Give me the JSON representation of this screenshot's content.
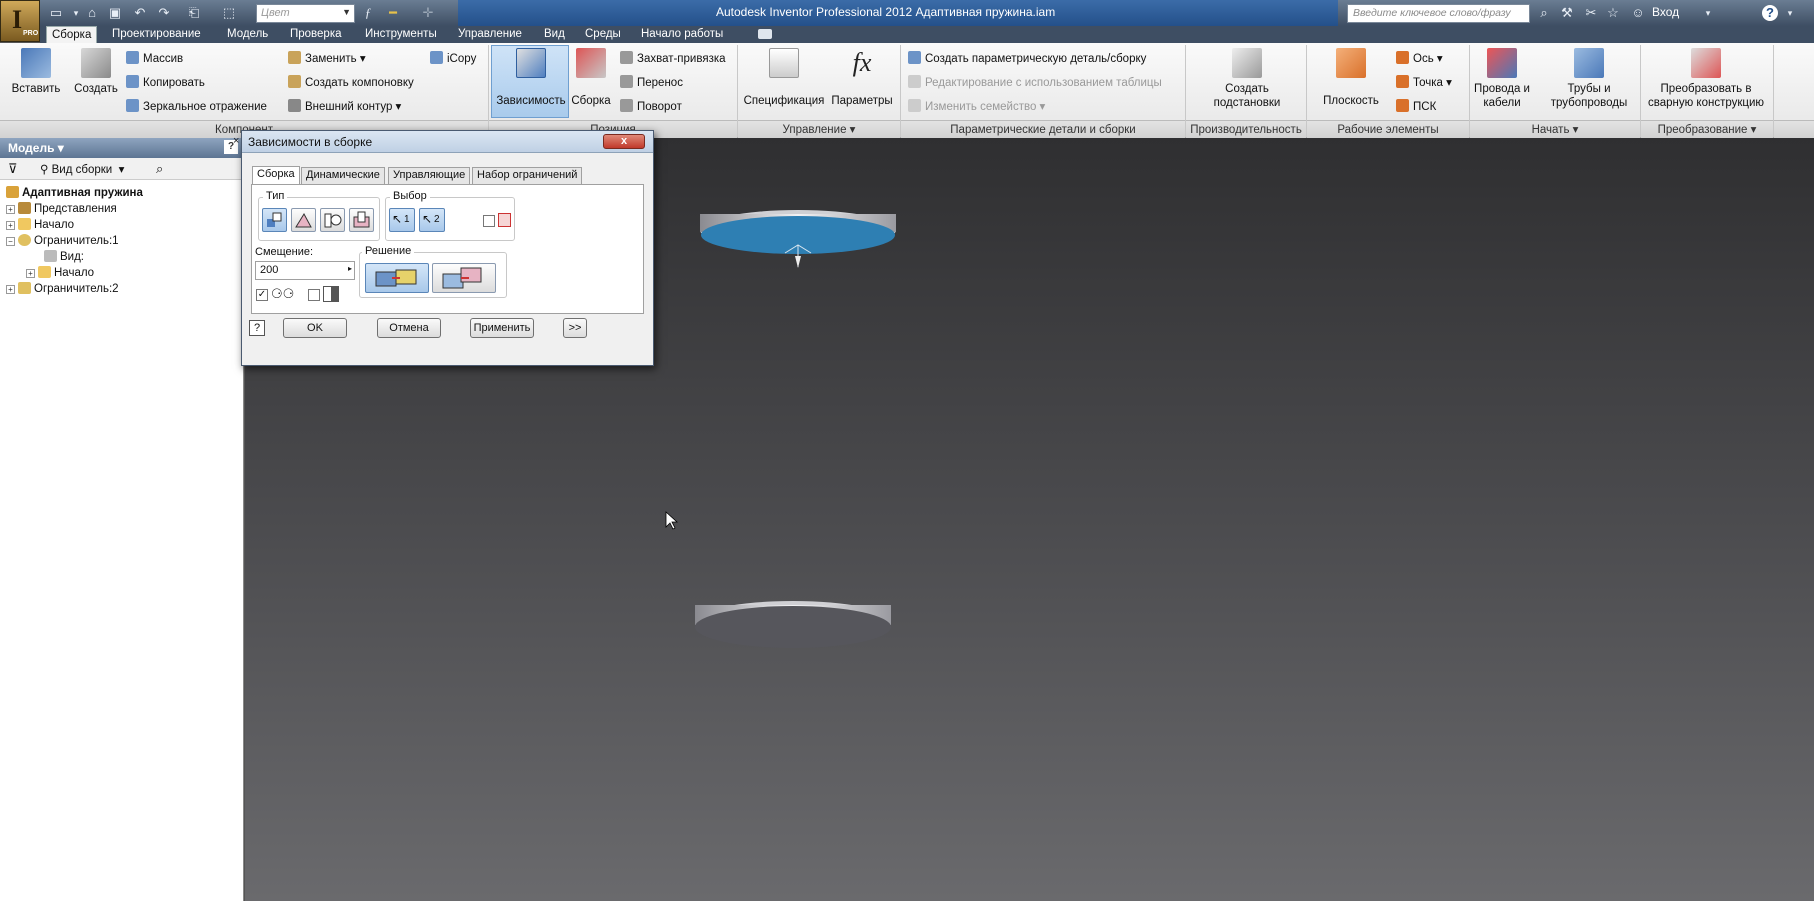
{
  "window": {
    "title": "Autodesk Inventor Professional 2012   Адаптивная пружина.iam",
    "app_badge": "PRO",
    "color_box": "Цвет",
    "search_placeholder": "Введите ключевое слово/фразу",
    "login": "Вход"
  },
  "tabs": [
    {
      "label": "Сборка",
      "active": true
    },
    {
      "label": "Проектирование"
    },
    {
      "label": "Модель"
    },
    {
      "label": "Проверка"
    },
    {
      "label": "Инструменты"
    },
    {
      "label": "Управление"
    },
    {
      "label": "Вид"
    },
    {
      "label": "Среды"
    },
    {
      "label": "Начало работы"
    }
  ],
  "ribbon": {
    "component": {
      "insert": "Вставить",
      "create": "Создать",
      "array": "Массив",
      "copy": "Копировать",
      "mirror": "Зеркальное отражение",
      "replace": "Заменить",
      "create_layout": "Создать компоновку",
      "outer_contour": "Внешний контур",
      "icopy": "iCopy",
      "group": "Компонент"
    },
    "position": {
      "constraint": "Зависимость",
      "assembly": "Сборка",
      "grip_snap": "Захват-привязка",
      "move": "Перенос",
      "rotate": "Поворот",
      "group": "Позиция"
    },
    "manage": {
      "bom": "Спецификация",
      "params": "Параметры",
      "group": "Управление"
    },
    "productivity_params": {
      "create_param": "Создать параметрическую деталь/сборку",
      "edit_table": "Редактирование с использованием таблицы",
      "change_family": "Изменить семейство",
      "group": "Параметрические детали и сборки"
    },
    "productivity": {
      "substitutes": "Создать подстановки",
      "group": "Производительность"
    },
    "work_features": {
      "plane": "Плоскость",
      "axis": "Ось",
      "point": "Точка",
      "ucs": "ПСК",
      "group": "Рабочие элементы"
    },
    "begin": {
      "wires": "Провода и кабели",
      "pipes": "Трубы и трубопроводы",
      "group": "Начать"
    },
    "convert": {
      "weldment": "Преобразовать в сварную конструкцию",
      "group": "Преобразование"
    }
  },
  "browser": {
    "header": "Модель",
    "view_dropdown": "Вид сборки",
    "tree": [
      {
        "label": "Адаптивная пружина",
        "bold": true
      },
      {
        "label": "Представления"
      },
      {
        "label": "Начало"
      },
      {
        "label": "Ограничитель:1"
      },
      {
        "label": "Вид:"
      },
      {
        "label": "Начало"
      },
      {
        "label": "Ограничитель:2"
      }
    ]
  },
  "dialog": {
    "title": "Зависимости в сборке",
    "tabs": [
      "Сборка",
      "Динамические",
      "Управляющие",
      "Набор ограничений"
    ],
    "type_label": "Тип",
    "select_label": "Выбор",
    "offset_label": "Смещение:",
    "offset_value": "200",
    "solution_label": "Решение",
    "sel1": "1",
    "sel2": "2",
    "ok": "OK",
    "cancel": "Отмена",
    "apply": "Применить",
    "more": ">>",
    "close": "x"
  },
  "colors": {
    "accent_blue": "#2e7fb3",
    "title_bar": "#3e4e63",
    "viewport_top": "#2f2f31",
    "viewport_bottom": "#6a6a6d"
  }
}
